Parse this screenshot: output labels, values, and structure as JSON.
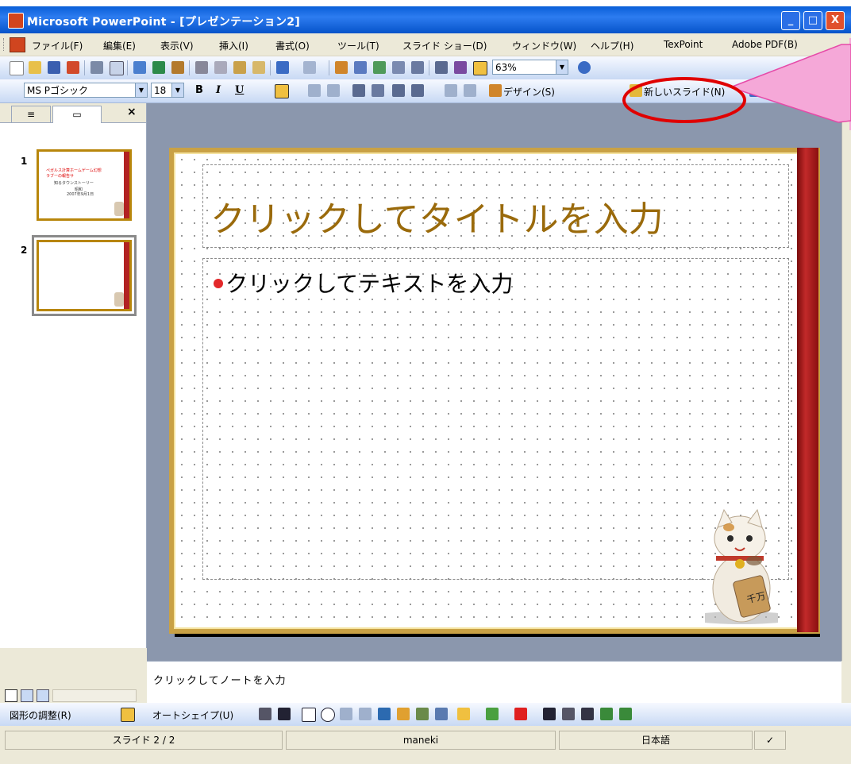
{
  "window": {
    "title": "Microsoft PowerPoint - [プレゼンテーション2]",
    "buttons": {
      "minimize": "_",
      "maximize": "□",
      "close": "X"
    }
  },
  "menu": [
    "ファイル(F)",
    "編集(E)",
    "表示(V)",
    "挿入(I)",
    "書式(O)",
    "ツール(T)",
    "スライド ショー(D)",
    "ウィンドウ(W)",
    "ヘルプ(H)",
    "TexPoint",
    "Adobe PDF(B)"
  ],
  "standard_toolbar": {
    "zoom": "63%",
    "help_icon": "help-icon"
  },
  "formatting_toolbar": {
    "font_name": "MS Pゴシック",
    "font_size": "18",
    "bold": "B",
    "italic": "I",
    "underline": "U",
    "design_label": "デザイン(S)",
    "new_slide_label": "新しいスライド(N)"
  },
  "left_pane": {
    "slides": [
      {
        "number": "1",
        "lines": [
          "ペガルス計算ホームゲーム幻想",
          "ラブーの報告サ",
          "知るタウンストーリー",
          "昭和",
          "2007年9月1日"
        ]
      },
      {
        "number": "2",
        "lines": []
      }
    ]
  },
  "slide": {
    "title_placeholder": "クリックしてタイトルを入力",
    "body_placeholder": "クリックしてテキストを入力"
  },
  "notes": {
    "placeholder": "クリックしてノートを入力"
  },
  "drawing_toolbar": {
    "draw_label": "図形の調整(R)",
    "autoshape_label": "オートシェイプ(U)"
  },
  "status": {
    "slide": "スライド 2 / 2",
    "design": "maneki",
    "language": "日本語"
  },
  "colors": {
    "accent_blue": "#0a5fd8",
    "title_gold": "#9a6a0b",
    "slide_red": "#b22222",
    "callout_pink": "#f5a8d8",
    "highlight_red": "#e00000"
  }
}
